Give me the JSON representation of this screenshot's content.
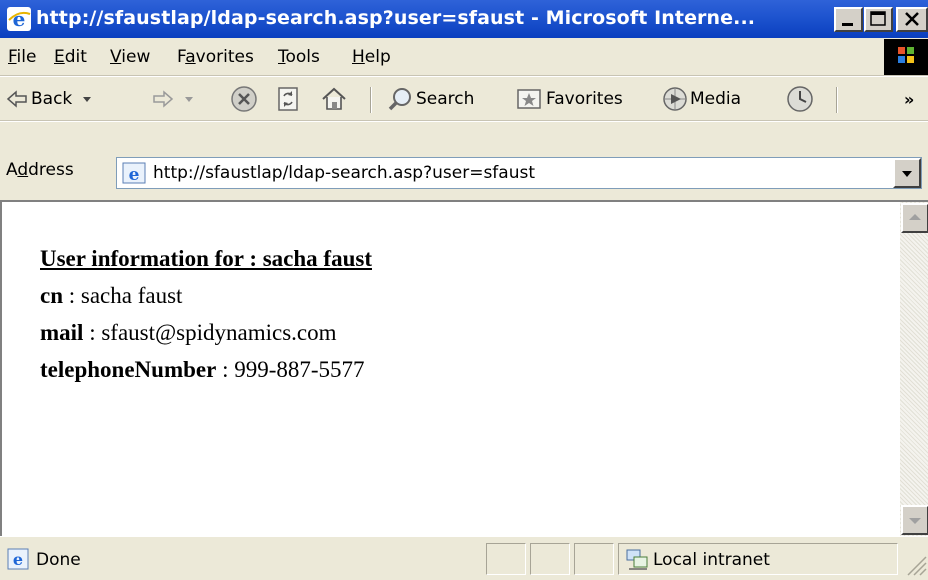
{
  "window": {
    "title": "http://sfaustlap/ldap-search.asp?user=sfaust - Microsoft Interne...",
    "title_bar_color": "#0a3fbf"
  },
  "menu": {
    "items": [
      {
        "accel": "F",
        "rest": "ile"
      },
      {
        "accel": "E",
        "rest": "dit"
      },
      {
        "accel": "V",
        "rest": "iew"
      },
      {
        "pre": "F",
        "accel": "a",
        "rest": "vorites"
      },
      {
        "accel": "T",
        "rest": "ools"
      },
      {
        "accel": "H",
        "rest": "elp"
      }
    ]
  },
  "toolbar": {
    "back_label": "Back",
    "search_label": "Search",
    "favorites_label": "Favorites",
    "media_label": "Media",
    "overflow_label": "»"
  },
  "address": {
    "label_pre": "A",
    "label_accel": "d",
    "label_rest": "dress",
    "url": "http://sfaustlap/ldap-search.asp?user=sfaust"
  },
  "page": {
    "heading": "User information for : sacha faust",
    "fields": [
      {
        "name": "cn",
        "separator": " : ",
        "value": "sacha faust"
      },
      {
        "name": "mail",
        "separator": " : ",
        "value": "sfaust@spidynamics.com"
      },
      {
        "name": "telephoneNumber",
        "separator": " : ",
        "value": "999-887-5577"
      }
    ]
  },
  "status": {
    "text": "Done",
    "zone": "Local intranet"
  },
  "icons": {
    "title": "ie-logo-icon",
    "menu_logo": "windows-flag-icon",
    "back": "back-arrow-icon",
    "forward": "forward-arrow-icon",
    "stop": "stop-icon",
    "refresh": "refresh-icon",
    "home": "home-icon",
    "search": "search-magnifier-icon",
    "favorites": "favorites-star-icon",
    "media": "media-icon",
    "history": "history-icon"
  }
}
